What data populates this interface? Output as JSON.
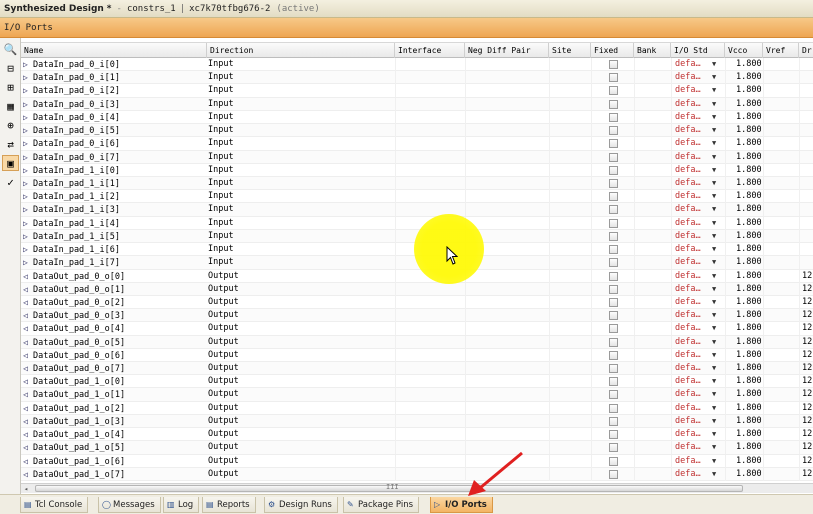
{
  "window": {
    "title": "Synthesized Design",
    "modified_marker": "*",
    "separator": "-",
    "constraints": "constrs_1",
    "bar": "|",
    "part": "xc7k70tfbg676-2",
    "state": "(active)"
  },
  "panel": {
    "title": "I/O Ports"
  },
  "toolbar": {
    "buttons": [
      {
        "name": "search-icon",
        "glyph": "🔍"
      },
      {
        "name": "collapse-all-icon",
        "glyph": "⊟"
      },
      {
        "name": "expand-all-icon",
        "glyph": "⊞"
      },
      {
        "name": "group-icon",
        "glyph": "▦"
      },
      {
        "name": "create-interface-icon",
        "glyph": "⊕"
      },
      {
        "name": "port-config-icon",
        "glyph": "⇄"
      },
      {
        "name": "auto-place-icon",
        "glyph": "▣"
      },
      {
        "name": "check-icon",
        "glyph": "✓"
      }
    ]
  },
  "columns": {
    "name": "Name",
    "direction": "Direction",
    "interface": "Interface",
    "neg_diff_pair": "Neg Diff Pair",
    "site": "Site",
    "fixed": "Fixed",
    "bank": "Bank",
    "io_std": "I/O Std",
    "vcco": "Vcco",
    "vref": "Vref",
    "drive": "Dr"
  },
  "rows": [
    {
      "name": "DataIn_pad_0_i[0]",
      "direction": "Input",
      "io_std": "defa…",
      "vcco": "1.800",
      "drive": ""
    },
    {
      "name": "DataIn_pad_0_i[1]",
      "direction": "Input",
      "io_std": "defa…",
      "vcco": "1.800",
      "drive": ""
    },
    {
      "name": "DataIn_pad_0_i[2]",
      "direction": "Input",
      "io_std": "defa…",
      "vcco": "1.800",
      "drive": ""
    },
    {
      "name": "DataIn_pad_0_i[3]",
      "direction": "Input",
      "io_std": "defa…",
      "vcco": "1.800",
      "drive": ""
    },
    {
      "name": "DataIn_pad_0_i[4]",
      "direction": "Input",
      "io_std": "defa…",
      "vcco": "1.800",
      "drive": ""
    },
    {
      "name": "DataIn_pad_0_i[5]",
      "direction": "Input",
      "io_std": "defa…",
      "vcco": "1.800",
      "drive": ""
    },
    {
      "name": "DataIn_pad_0_i[6]",
      "direction": "Input",
      "io_std": "defa…",
      "vcco": "1.800",
      "drive": ""
    },
    {
      "name": "DataIn_pad_0_i[7]",
      "direction": "Input",
      "io_std": "defa…",
      "vcco": "1.800",
      "drive": ""
    },
    {
      "name": "DataIn_pad_1_i[0]",
      "direction": "Input",
      "io_std": "defa…",
      "vcco": "1.800",
      "drive": ""
    },
    {
      "name": "DataIn_pad_1_i[1]",
      "direction": "Input",
      "io_std": "defa…",
      "vcco": "1.800",
      "drive": ""
    },
    {
      "name": "DataIn_pad_1_i[2]",
      "direction": "Input",
      "io_std": "defa…",
      "vcco": "1.800",
      "drive": ""
    },
    {
      "name": "DataIn_pad_1_i[3]",
      "direction": "Input",
      "io_std": "defa…",
      "vcco": "1.800",
      "drive": ""
    },
    {
      "name": "DataIn_pad_1_i[4]",
      "direction": "Input",
      "io_std": "defa…",
      "vcco": "1.800",
      "drive": ""
    },
    {
      "name": "DataIn_pad_1_i[5]",
      "direction": "Input",
      "io_std": "defa…",
      "vcco": "1.800",
      "drive": ""
    },
    {
      "name": "DataIn_pad_1_i[6]",
      "direction": "Input",
      "io_std": "defa…",
      "vcco": "1.800",
      "drive": ""
    },
    {
      "name": "DataIn_pad_1_i[7]",
      "direction": "Input",
      "io_std": "defa…",
      "vcco": "1.800",
      "drive": ""
    },
    {
      "name": "DataOut_pad_0_o[0]",
      "direction": "Output",
      "io_std": "defa…",
      "vcco": "1.800",
      "drive": "12"
    },
    {
      "name": "DataOut_pad_0_o[1]",
      "direction": "Output",
      "io_std": "defa…",
      "vcco": "1.800",
      "drive": "12"
    },
    {
      "name": "DataOut_pad_0_o[2]",
      "direction": "Output",
      "io_std": "defa…",
      "vcco": "1.800",
      "drive": "12"
    },
    {
      "name": "DataOut_pad_0_o[3]",
      "direction": "Output",
      "io_std": "defa…",
      "vcco": "1.800",
      "drive": "12"
    },
    {
      "name": "DataOut_pad_0_o[4]",
      "direction": "Output",
      "io_std": "defa…",
      "vcco": "1.800",
      "drive": "12"
    },
    {
      "name": "DataOut_pad_0_o[5]",
      "direction": "Output",
      "io_std": "defa…",
      "vcco": "1.800",
      "drive": "12"
    },
    {
      "name": "DataOut_pad_0_o[6]",
      "direction": "Output",
      "io_std": "defa…",
      "vcco": "1.800",
      "drive": "12"
    },
    {
      "name": "DataOut_pad_0_o[7]",
      "direction": "Output",
      "io_std": "defa…",
      "vcco": "1.800",
      "drive": "12"
    },
    {
      "name": "DataOut_pad_1_o[0]",
      "direction": "Output",
      "io_std": "defa…",
      "vcco": "1.800",
      "drive": "12"
    },
    {
      "name": "DataOut_pad_1_o[1]",
      "direction": "Output",
      "io_std": "defa…",
      "vcco": "1.800",
      "drive": "12"
    },
    {
      "name": "DataOut_pad_1_o[2]",
      "direction": "Output",
      "io_std": "defa…",
      "vcco": "1.800",
      "drive": "12"
    },
    {
      "name": "DataOut_pad_1_o[3]",
      "direction": "Output",
      "io_std": "defa…",
      "vcco": "1.800",
      "drive": "12"
    },
    {
      "name": "DataOut_pad_1_o[4]",
      "direction": "Output",
      "io_std": "defa…",
      "vcco": "1.800",
      "drive": "12"
    },
    {
      "name": "DataOut_pad_1_o[5]",
      "direction": "Output",
      "io_std": "defa…",
      "vcco": "1.800",
      "drive": "12"
    },
    {
      "name": "DataOut_pad_1_o[6]",
      "direction": "Output",
      "io_std": "defa…",
      "vcco": "1.800",
      "drive": "12"
    },
    {
      "name": "DataOut_pad_1_o[7]",
      "direction": "Output",
      "io_std": "defa…",
      "vcco": "1.800",
      "drive": "12"
    }
  ],
  "scrollbar": {
    "grip": "III"
  },
  "tabs": [
    {
      "label": "Tcl Console",
      "icon": "tcl-console-icon",
      "glyph": "▤",
      "active": false
    },
    {
      "label": "Messages",
      "icon": "messages-icon",
      "glyph": "◯",
      "active": false
    },
    {
      "label": "Log",
      "icon": "log-icon",
      "glyph": "▥",
      "active": false
    },
    {
      "label": "Reports",
      "icon": "reports-icon",
      "glyph": "▤",
      "active": false
    },
    {
      "label": "Design Runs",
      "icon": "design-runs-icon",
      "glyph": "⚙",
      "active": false
    },
    {
      "label": "Package Pins",
      "icon": "package-pins-icon",
      "glyph": "✎",
      "active": false
    },
    {
      "label": "I/O Ports",
      "icon": "io-ports-icon",
      "glyph": "▷",
      "active": true
    }
  ],
  "colors": {
    "panel_header": "#eea552",
    "active_tab": "#f3b464",
    "io_std_text": "#c03030",
    "highlight": "#fffa00",
    "annotation_arrow": "#e02020"
  }
}
